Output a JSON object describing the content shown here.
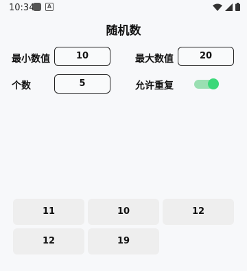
{
  "status_bar": {
    "time": "10:34",
    "icons": [
      "wifi-icon",
      "signal-icon",
      "battery-icon"
    ]
  },
  "header": {
    "title": "随机数"
  },
  "form": {
    "min_label": "最小数值",
    "min_value": "10",
    "max_label": "最大数值",
    "max_value": "20",
    "count_label": "个数",
    "count_value": "5",
    "allow_repeat_label": "允许重复",
    "allow_repeat_on": true
  },
  "results": [
    "11",
    "10",
    "12",
    "12",
    "19"
  ],
  "colors": {
    "toggle_track": "#9adfb2",
    "toggle_knob": "#3cd879",
    "result_bg": "#eeeeee",
    "page_bg": "#f7f8fa"
  }
}
